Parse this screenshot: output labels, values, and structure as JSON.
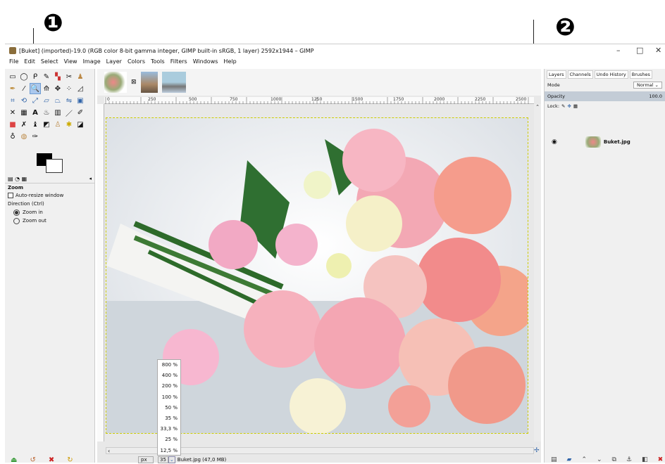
{
  "callouts": {
    "one": "❶",
    "two": "❷"
  },
  "window": {
    "title": "[Buket] (imported)-19.0 (RGB color 8-bit gamma integer, GIMP built-in sRGB, 1 layer) 2592x1944 – GIMP"
  },
  "menu": [
    "File",
    "Edit",
    "Select",
    "View",
    "Image",
    "Layer",
    "Colors",
    "Tools",
    "Filters",
    "Windows",
    "Help"
  ],
  "tool_options": {
    "title": "Zoom",
    "auto_resize": "Auto-resize window",
    "direction_label": "Direction  (Ctrl)",
    "zoom_in": "Zoom in",
    "zoom_out": "Zoom out"
  },
  "ruler_ticks": [
    "0",
    "250",
    "500",
    "750",
    "1000",
    "1250",
    "1500",
    "1750",
    "2000",
    "2250",
    "2500"
  ],
  "zoom_options": [
    "800 %",
    "400 %",
    "200 %",
    "100 %",
    "50 %",
    "35 %",
    "33,3 %",
    "25 %",
    "12,5 %"
  ],
  "status": {
    "unit": "px",
    "zoom_value": "35",
    "file_info": "Buket.jpg (47,0 MB)"
  },
  "dock": {
    "tabs": [
      "Layers",
      "Channels",
      "Undo History",
      "Brushes"
    ],
    "mode_label": "Mode",
    "mode_value": "Normal",
    "opacity_label": "Opacity",
    "opacity_value": "100.0",
    "lock_label": "Lock:",
    "layer_name": "Buket.jpg"
  },
  "colors": {
    "accent": "#aac8ee",
    "dialog_bg": "#f0f0f0"
  }
}
